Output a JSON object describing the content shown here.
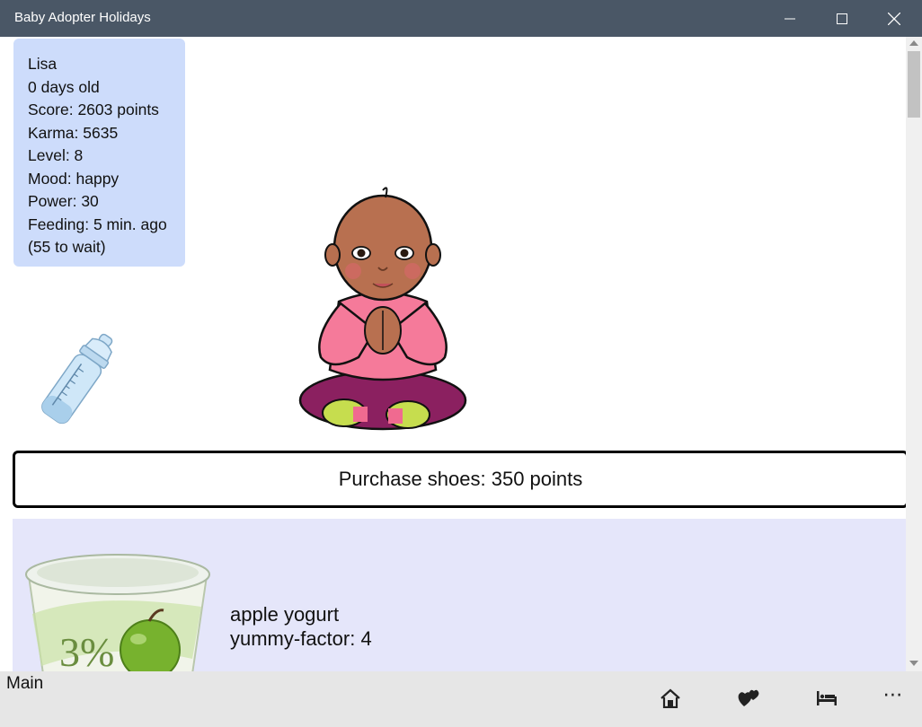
{
  "window": {
    "title": "Baby Adopter Holidays",
    "controls": [
      "minimize-icon",
      "maximize-icon",
      "close-icon"
    ]
  },
  "stats": [
    "Lisa",
    "0 days old",
    "Score: 2603 points",
    "Karma: 5635",
    "Level: 8",
    "Mood: happy",
    "Power: 30",
    "Feeding: 5 min. ago",
    "(55 to wait)"
  ],
  "purchase_button": {
    "label": "Purchase shoes: 350 points"
  },
  "food_item": {
    "name": "apple yogurt",
    "yummy": "yummy-factor: 4",
    "badge": "3%"
  },
  "appbar": {
    "title": "Main",
    "buttons": [
      "home-icon",
      "hearts-icon",
      "bed-icon",
      "more-icon"
    ],
    "more_label": "⋯"
  },
  "colors": {
    "titlebar": "#4a5766",
    "stats_panel": "#cddcfb",
    "food_panel": "#e5e6fa",
    "appbar": "#e6e6e6",
    "shirt": "#f57a9a",
    "pants": "#8b2060",
    "skin": "#b87050"
  }
}
